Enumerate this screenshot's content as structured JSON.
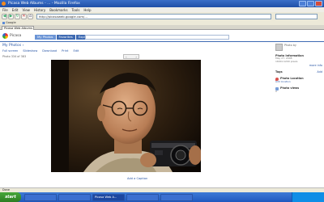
{
  "window": {
    "title": "Picasa Web Albums - ... - Mozilla Firefox"
  },
  "menubar": {
    "items": [
      "File",
      "Edit",
      "View",
      "History",
      "Bookmarks",
      "Tools",
      "Help"
    ]
  },
  "navbar": {
    "url": "http://picasaweb.google.com/..."
  },
  "bookmarks": {
    "items": [
      "Google"
    ]
  },
  "tab": {
    "label": "Picasa Web Albums"
  },
  "picasa": {
    "logo": "Picasa",
    "tabs": [
      "My Photos",
      "Favorites",
      "Explore"
    ],
    "account": {
      "email": "",
      "links": ""
    }
  },
  "breadcrumb": {
    "root": "My Photos",
    "separator": " › ",
    "current": ""
  },
  "actions": [
    "Full screen",
    "Slideshow",
    "Download",
    "Print",
    "Edit"
  ],
  "photo_info_line": "Photo 334 of 383",
  "photo": {
    "caption_link": "Add a Caption"
  },
  "sidebar": {
    "photo_by_label": "Photo by",
    "owner": "",
    "info_title": "Photo Information",
    "info_lines": [
      "May 27, 2008",
      "1600×1200 pixels"
    ],
    "more_info": "more info",
    "add_user_link": "",
    "tags_title": "Tags",
    "add_tags": "Add",
    "location_title": "Photo Location",
    "add_location": "Add location",
    "views_title": "Photo views",
    "views_text": "0"
  },
  "statusbar": {
    "text": "Done"
  },
  "taskbar": {
    "start": "start",
    "items": [
      "",
      "",
      "Picasa Web A...",
      "",
      ""
    ],
    "clock": ""
  }
}
